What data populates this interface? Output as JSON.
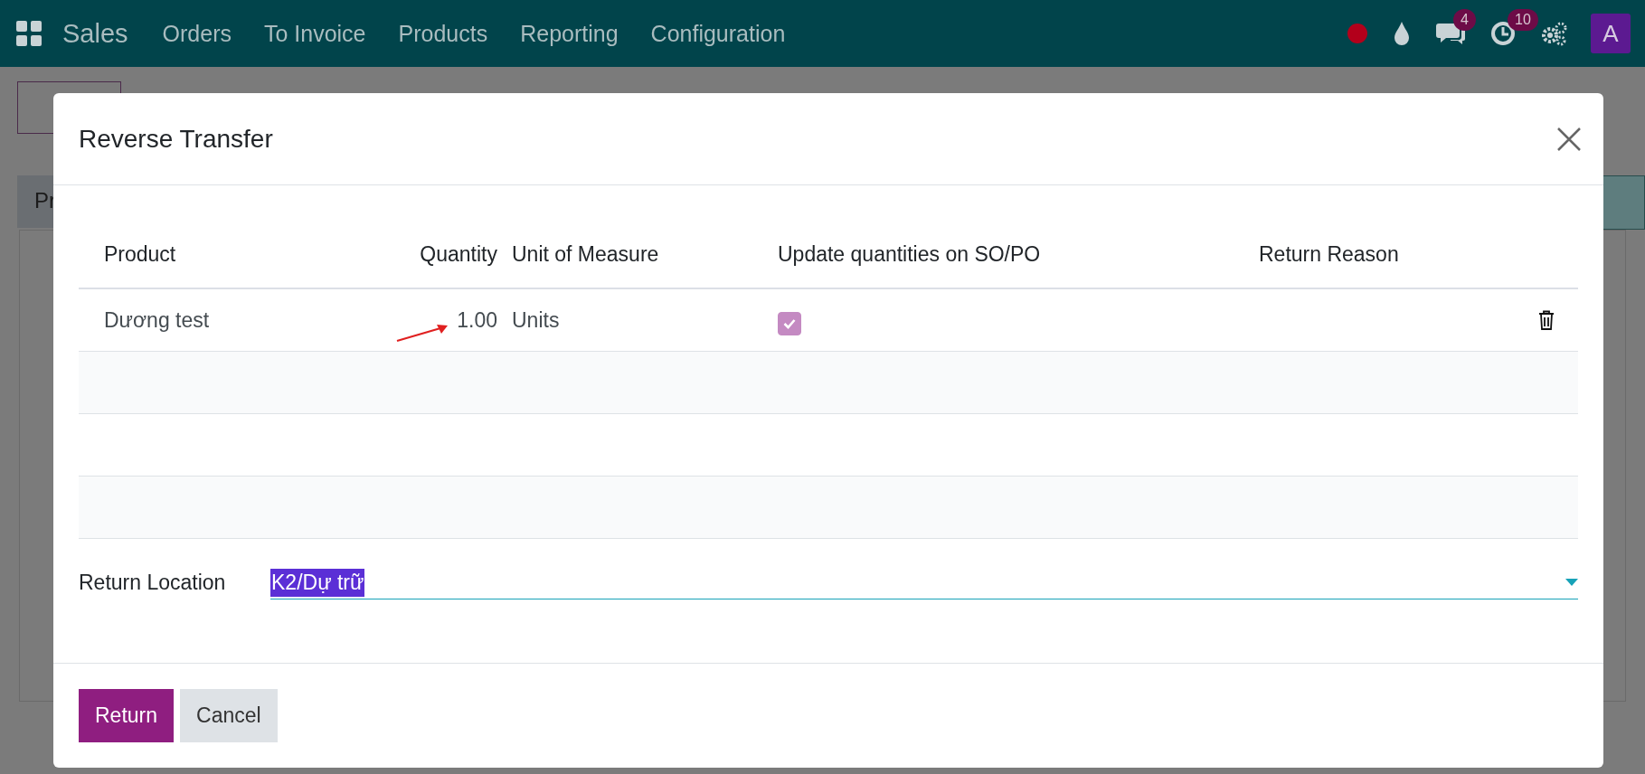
{
  "navbar": {
    "app": "Sales",
    "menu": [
      "Orders",
      "To Invoice",
      "Products",
      "Reporting",
      "Configuration"
    ],
    "messages_badge": "4",
    "activities_badge": "10",
    "avatar": "A"
  },
  "background": {
    "status_tab": "Pr"
  },
  "dialog": {
    "title": "Reverse Transfer",
    "columns": [
      "Product",
      "Quantity",
      "Unit of Measure",
      "Update quantities on SO/PO",
      "Return Reason"
    ],
    "rows": [
      {
        "product": "Dương test",
        "quantity": "1.00",
        "uom": "Units",
        "update_quantities": true
      }
    ],
    "return_location": {
      "label": "Return Location",
      "value": "K2/Dự trữ"
    },
    "buttons": [
      {
        "label": "Return",
        "kind": "primary"
      },
      {
        "label": "Cancel",
        "kind": "secondary"
      }
    ]
  }
}
